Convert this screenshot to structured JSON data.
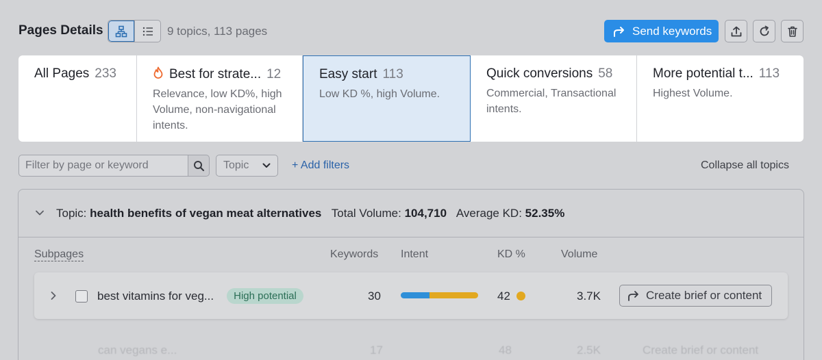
{
  "header": {
    "title": "Pages Details",
    "summary": "9 topics, 113 pages",
    "send_keywords": "Send keywords",
    "view_options": [
      "grouped-view-icon",
      "list-view-icon"
    ]
  },
  "tabs": [
    {
      "label": "All Pages",
      "count": "233",
      "description": ""
    },
    {
      "label": "Best for strate...",
      "count": "12",
      "description": "Relevance, low KD%, high Volume, non-navigational intents.",
      "icon": "fire-icon"
    },
    {
      "label": "Easy start",
      "count": "113",
      "description": "Low KD %, high Volume.",
      "active": true
    },
    {
      "label": "Quick conversions",
      "count": "58",
      "description": "Commercial, Transactional intents."
    },
    {
      "label": "More potential t...",
      "count": "113",
      "description": "Highest Volume."
    }
  ],
  "filters": {
    "search_placeholder": "Filter by page or keyword",
    "topic_select": "Topic",
    "add_filters": "+ Add filters",
    "collapse_all": "Collapse all topics"
  },
  "topic": {
    "label": "Topic:",
    "name": "health benefits of vegan meat alternatives",
    "total_volume_label": "Total Volume:",
    "total_volume": "104,710",
    "avg_kd_label": "Average KD:",
    "avg_kd": "52.35%"
  },
  "columns": {
    "subpages": "Subpages",
    "keywords": "Keywords",
    "intent": "Intent",
    "kd": "KD %",
    "volume": "Volume"
  },
  "rows": [
    {
      "page": "best vitamins for veg...",
      "badge": "High potential",
      "keywords": "30",
      "intent_split": [
        0.37,
        0.63
      ],
      "kd": "42",
      "volume": "3.7K",
      "action": "Create brief or content"
    }
  ],
  "faded_row": {
    "page": "can vegans e...",
    "keywords": "17",
    "kd": "48",
    "volume": "2.5K",
    "action": "Create brief or content"
  },
  "colors": {
    "accent": "#2a8de6",
    "intent_informational": "#2f8fd8",
    "intent_commercial": "#e2a820",
    "kd_dot": "#e2a820",
    "badge_bg": "#b9d6cd"
  }
}
